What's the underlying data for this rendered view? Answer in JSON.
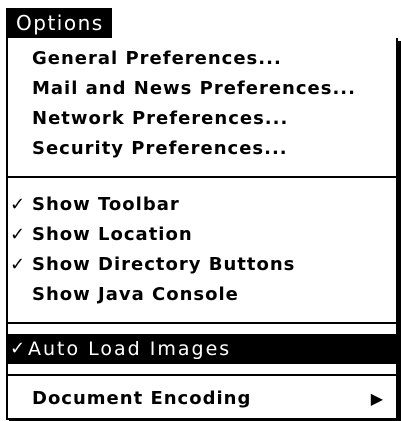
{
  "menu": {
    "title": "Options",
    "group1": [
      {
        "label": "General Preferences..."
      },
      {
        "label": "Mail and News Preferences..."
      },
      {
        "label": "Network Preferences..."
      },
      {
        "label": "Security Preferences..."
      }
    ],
    "group2": [
      {
        "label": "Show Toolbar",
        "checked": true,
        "check": "✓"
      },
      {
        "label": "Show Location",
        "checked": true,
        "check": "✓"
      },
      {
        "label": "Show Directory Buttons",
        "checked": true,
        "check": "✓"
      },
      {
        "label": "Show Java Console",
        "checked": false,
        "check": ""
      }
    ],
    "group3": [
      {
        "label": "Auto Load Images",
        "checked": true,
        "check": "✓",
        "highlighted": true
      }
    ],
    "group4": [
      {
        "label": "Document Encoding",
        "submenu_arrow": "▶"
      }
    ]
  }
}
